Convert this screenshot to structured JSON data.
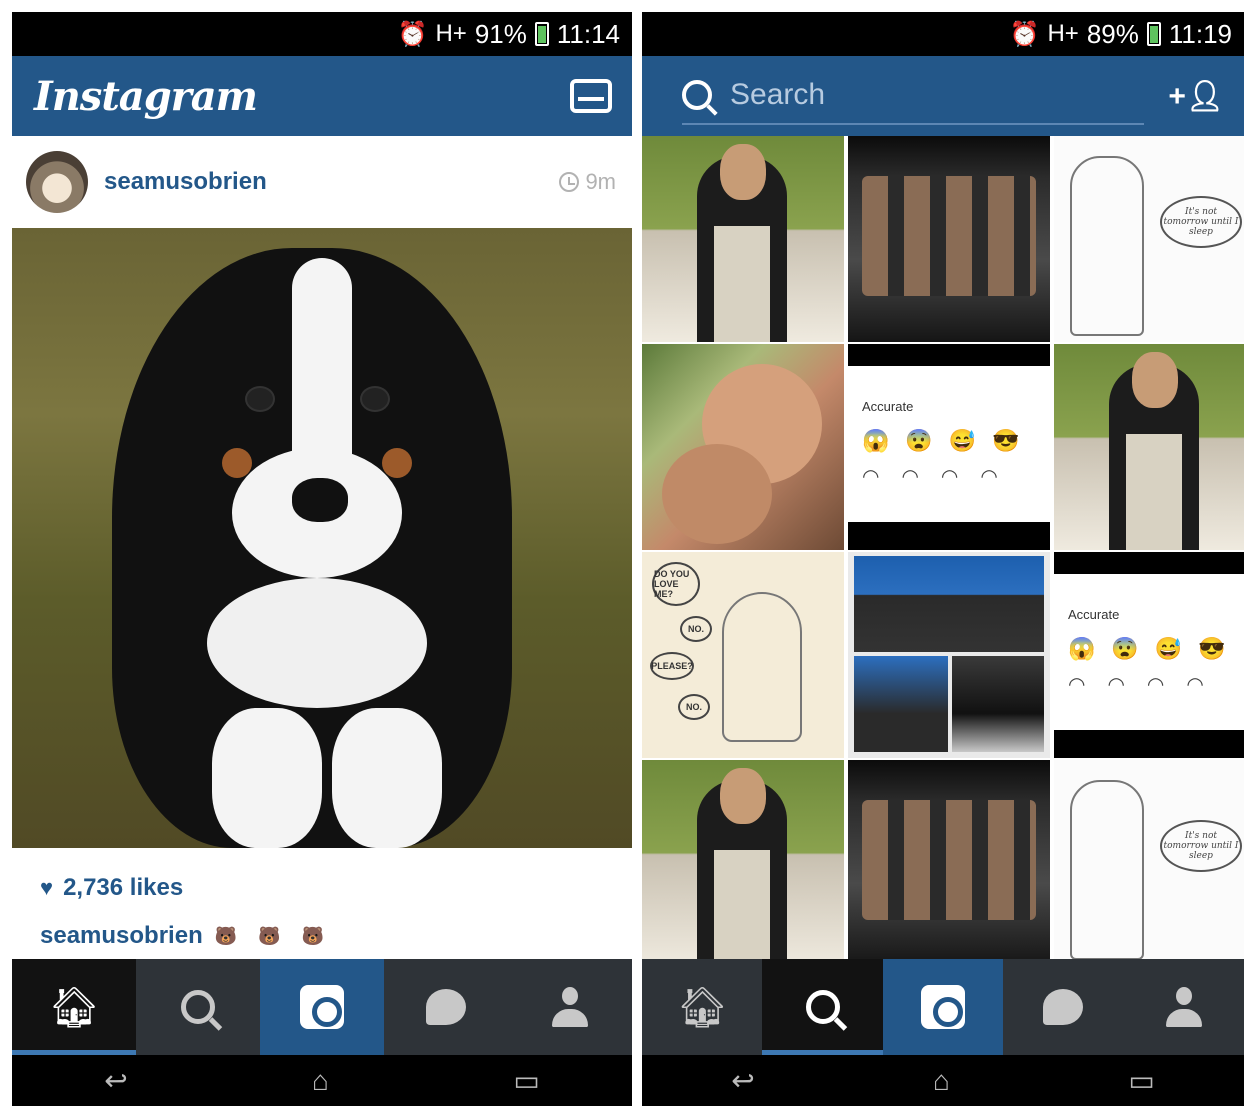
{
  "left": {
    "status": {
      "signal": "H+",
      "battery": "91%",
      "time": "11:14"
    },
    "app_title": "Instagram",
    "post": {
      "username": "seamusobrien",
      "time_ago": "9m",
      "likes": "2,736 likes",
      "caption_user": "seamusobrien",
      "caption_text": "🐻 🐻 🐻"
    },
    "tabs": [
      "home",
      "search",
      "camera",
      "activity",
      "profile"
    ],
    "active_tab": "home"
  },
  "right": {
    "status": {
      "signal": "H+",
      "battery": "89%",
      "time": "11:19"
    },
    "search": {
      "placeholder": "Search",
      "add_user_label": "+"
    },
    "grid_tiles": [
      {
        "kind": "photo-man-sunglasses"
      },
      {
        "kind": "photo-group-shirtless"
      },
      {
        "kind": "sketch-speech-bubble",
        "bubble_text": "It's not tomorrow until I sleep"
      },
      {
        "kind": "photo-couple"
      },
      {
        "kind": "meme-accurate",
        "title": "Accurate"
      },
      {
        "kind": "photo-man-sunglasses"
      },
      {
        "kind": "comic-do-you-love-me",
        "bubbles": [
          "DO YOU LOVE ME?",
          "NO.",
          "PLEASE?",
          "NO."
        ]
      },
      {
        "kind": "photo-collage-event"
      },
      {
        "kind": "meme-accurate",
        "title": "Accurate"
      },
      {
        "kind": "photo-man-sunglasses"
      },
      {
        "kind": "photo-group-shirtless"
      },
      {
        "kind": "sketch-speech-bubble",
        "bubble_text": "It's not tomorrow until I sleep"
      }
    ],
    "tabs": [
      "home",
      "search",
      "camera",
      "activity",
      "profile"
    ],
    "active_tab": "search"
  },
  "nav_buttons": [
    "back",
    "home",
    "recents"
  ],
  "colors": {
    "brand_blue": "#235789",
    "tab_bg": "#2e3338",
    "active_indicator": "#3d78b3"
  }
}
